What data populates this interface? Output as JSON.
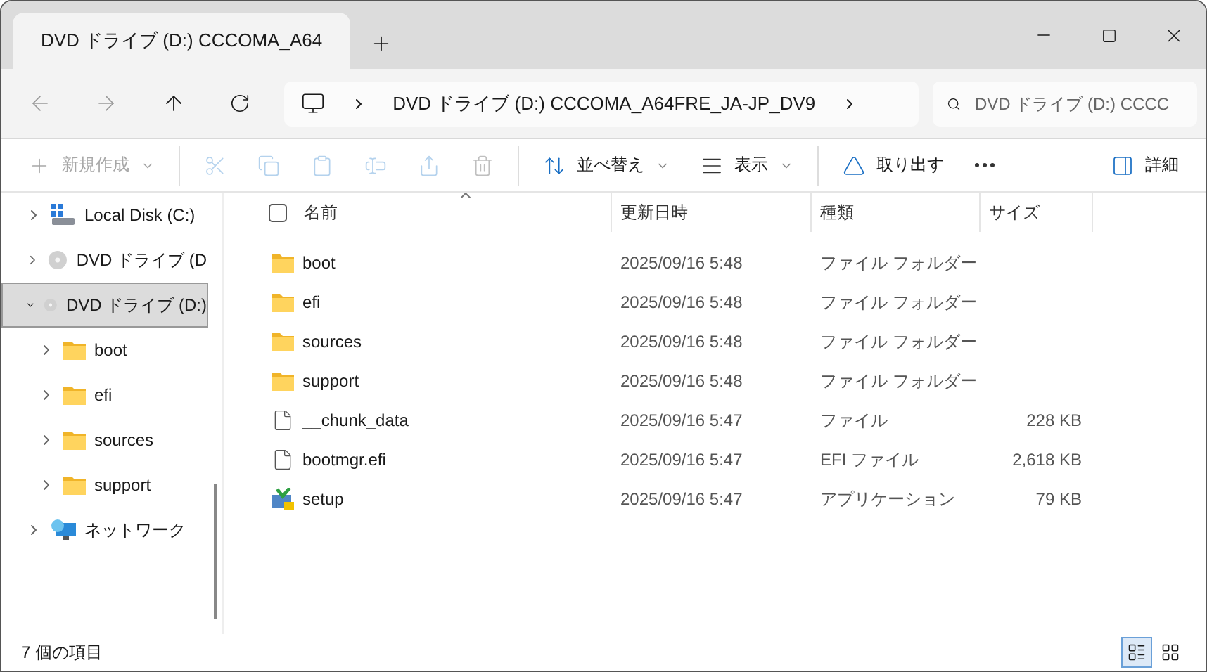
{
  "tab": {
    "title": "DVD ドライブ (D:) CCCOMA_A64"
  },
  "address": {
    "crumbs": [
      "DVD ドライブ (D:) CCCOMA_A64FRE_JA-JP_DV9"
    ]
  },
  "search": {
    "placeholder": "DVD ドライブ (D:) CCCC"
  },
  "toolbar": [
    {
      "kind": "new",
      "label": "新規作成",
      "disabled": true
    },
    {
      "kind": "cut",
      "disabled": true
    },
    {
      "kind": "copy",
      "disabled": true
    },
    {
      "kind": "paste",
      "disabled": true
    },
    {
      "kind": "rename",
      "disabled": true
    },
    {
      "kind": "share",
      "disabled": true
    },
    {
      "kind": "delete",
      "disabled": true
    },
    {
      "kind": "sort",
      "label": "並べ替え",
      "disabled": false
    },
    {
      "kind": "view",
      "label": "表示",
      "disabled": false
    },
    {
      "kind": "eject",
      "label": "取り出す",
      "disabled": false
    },
    {
      "kind": "more",
      "disabled": false
    },
    {
      "kind": "details",
      "label": "詳細",
      "disabled": false
    }
  ],
  "sidebar": {
    "items": [
      {
        "kind": "disk",
        "label": "Local Disk (C:)",
        "expanded": false,
        "selected": false
      },
      {
        "kind": "dvd",
        "label": "DVD ドライブ (D",
        "expanded": false,
        "selected": false
      },
      {
        "kind": "dvd",
        "label": "DVD ドライブ (D:)",
        "expanded": true,
        "selected": true,
        "children": [
          {
            "kind": "folder",
            "label": "boot",
            "expanded": false,
            "selected": false
          },
          {
            "kind": "folder",
            "label": "efi",
            "expanded": false,
            "selected": false
          },
          {
            "kind": "folder",
            "label": "sources",
            "expanded": false,
            "selected": false
          },
          {
            "kind": "folder",
            "label": "support",
            "expanded": false,
            "selected": false
          }
        ]
      },
      {
        "kind": "network",
        "label": "ネットワーク",
        "expanded": false,
        "selected": false
      }
    ]
  },
  "table": {
    "select_all": {
      "checked": false
    },
    "columns": [
      "名前",
      "更新日時",
      "種類",
      "サイズ"
    ],
    "rows": [
      {
        "kind": "folder",
        "name": "boot",
        "date": "2025/09/16 5:48",
        "type": "ファイル フォルダー"
      },
      {
        "kind": "folder",
        "name": "efi",
        "date": "2025/09/16 5:48",
        "type": "ファイル フォルダー"
      },
      {
        "kind": "folder",
        "name": "sources",
        "date": "2025/09/16 5:48",
        "type": "ファイル フォルダー"
      },
      {
        "kind": "folder",
        "name": "support",
        "date": "2025/09/16 5:48",
        "type": "ファイル フォルダー"
      },
      {
        "kind": "file",
        "name": "__chunk_data",
        "date": "2025/09/16 5:47",
        "type": "ファイル",
        "size": "228 KB"
      },
      {
        "kind": "file",
        "name": "bootmgr.efi",
        "date": "2025/09/16 5:47",
        "type": "EFI ファイル",
        "size": "2,618 KB"
      },
      {
        "kind": "app",
        "name": "setup",
        "date": "2025/09/16 5:47",
        "type": "アプリケーション",
        "size": "79 KB"
      }
    ]
  },
  "status_bar": {
    "count": "7 個の項目",
    "views": [
      {
        "kind": "details",
        "selected": true
      },
      {
        "kind": "tiles",
        "selected": false
      }
    ]
  }
}
